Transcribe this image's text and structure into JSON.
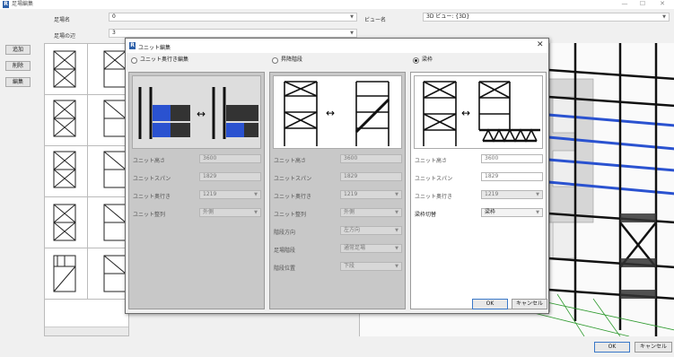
{
  "window": {
    "title": "足場編集",
    "minimize": "—",
    "maximize": "☐",
    "close": "✕"
  },
  "top": {
    "name_label": "足場名",
    "name_value": "0",
    "view_label": "ビュー名",
    "view_value": "3D ビュー: {3D}",
    "side_label": "足場の辺",
    "side_value": "3"
  },
  "side_buttons": {
    "add": "追加",
    "delete": "削除",
    "edit": "編集"
  },
  "dialog": {
    "title": "ユニット編集",
    "close": "✕",
    "panels": [
      {
        "option": "ユニット奥行き編集",
        "selected": false,
        "fields": [
          {
            "label": "ユニット高さ",
            "value": "3600",
            "dropdown": false
          },
          {
            "label": "ユニットスパン",
            "value": "1829",
            "dropdown": false
          },
          {
            "label": "ユニット奥行き",
            "value": "1219",
            "dropdown": true
          },
          {
            "label": "ユニット整列",
            "value": "外側",
            "dropdown": true
          }
        ]
      },
      {
        "option": "昇降階段",
        "selected": false,
        "fields": [
          {
            "label": "ユニット高さ",
            "value": "3600",
            "dropdown": false
          },
          {
            "label": "ユニットスパン",
            "value": "1829",
            "dropdown": false
          },
          {
            "label": "ユニット奥行き",
            "value": "1219",
            "dropdown": true
          },
          {
            "label": "ユニット整列",
            "value": "外側",
            "dropdown": true
          },
          {
            "label": "階段方向",
            "value": "左方向",
            "dropdown": true
          },
          {
            "label": "足場階段",
            "value": "通常足場",
            "dropdown": true
          },
          {
            "label": "階段位置",
            "value": "下段",
            "dropdown": true
          }
        ]
      },
      {
        "option": "梁枠",
        "selected": true,
        "fields": [
          {
            "label": "ユニット高さ",
            "value": "3600",
            "dropdown": false
          },
          {
            "label": "ユニットスパン",
            "value": "1829",
            "dropdown": false
          },
          {
            "label": "ユニット奥行き",
            "value": "1219",
            "dropdown": true
          },
          {
            "label": "梁枠切替",
            "value": "梁枠",
            "dropdown": true
          }
        ]
      }
    ],
    "ok": "OK",
    "cancel": "キャンセル"
  },
  "bottom": {
    "ok": "OK",
    "cancel": "キャンセル"
  },
  "colors": {
    "accent": "#3a78c8",
    "blue_unit": "#2a52d0"
  }
}
